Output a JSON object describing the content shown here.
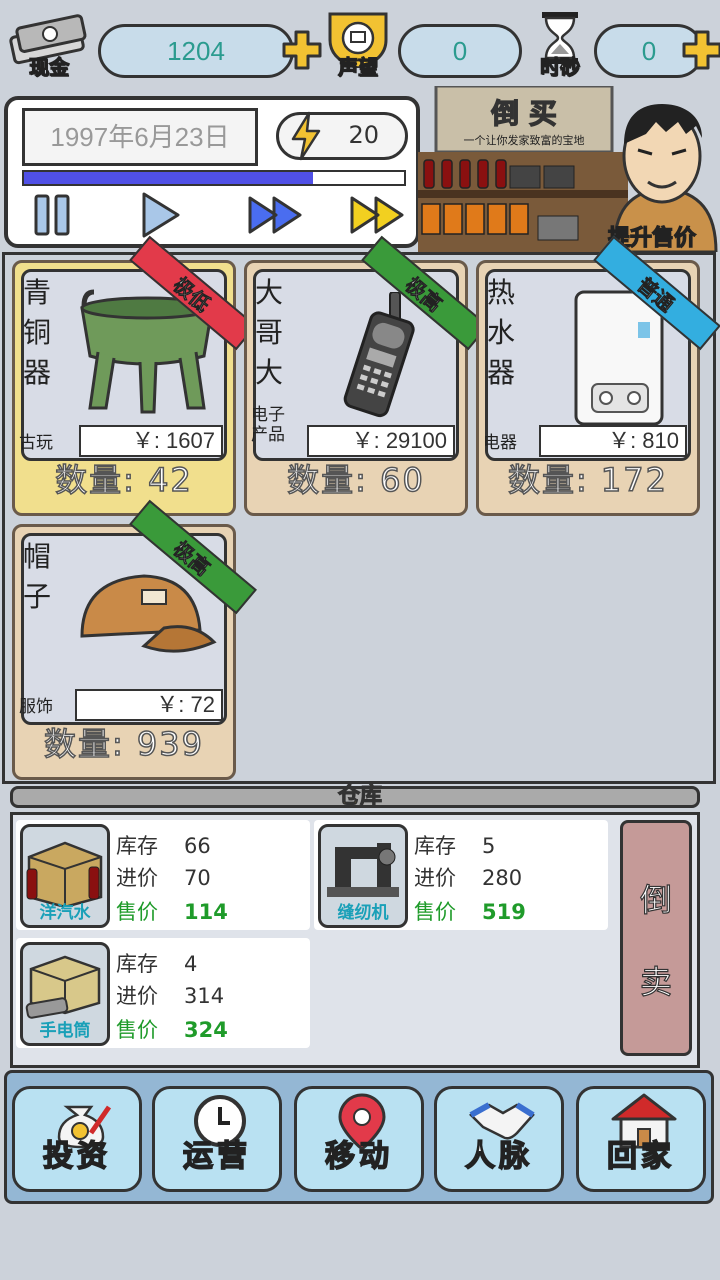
{
  "resources": [
    {
      "label": "现金",
      "value": "1204",
      "icon": "cash-icon"
    },
    {
      "label": "声望",
      "value": "0",
      "icon": "reputation-fist-icon"
    },
    {
      "label": "时砂",
      "value": "0",
      "icon": "hourglass-icon"
    }
  ],
  "clock": {
    "date": "1997年6月23日",
    "energy": "20",
    "progress": 0.76
  },
  "shop": {
    "sign_title": "倒 买",
    "sign_subtitle": "一个让你发家致富的宝地",
    "action_label": "提升售价"
  },
  "items": [
    {
      "name": "青铜器",
      "category": "古玩",
      "price": "￥: 1607",
      "quantity": "数量: 42",
      "tag": "极低",
      "tag_color": "#e23a4a",
      "selected": true
    },
    {
      "name": "大哥大",
      "category": "电子产品",
      "price": "￥: 29100",
      "quantity": "数量: 60",
      "tag": "极高",
      "tag_color": "#3a9a3a",
      "selected": false
    },
    {
      "name": "热水器",
      "category": "电器",
      "price": "￥: 810",
      "quantity": "数量: 172",
      "tag": "普通",
      "tag_color": "#33aee0",
      "selected": false
    },
    {
      "name": "帽子",
      "category": "服饰",
      "price": "￥: 72",
      "quantity": "数量: 939",
      "tag": "极高",
      "tag_color": "#3a9a3a",
      "selected": false
    }
  ],
  "warehouse": {
    "title": "仓库",
    "stock_label": "库存",
    "cost_label": "进价",
    "sell_label": "售价",
    "items": [
      {
        "name": "洋汽水",
        "stock": "66",
        "cost": "70",
        "sell": "114"
      },
      {
        "name": "缝纫机",
        "stock": "5",
        "cost": "280",
        "sell": "519"
      },
      {
        "name": "手电筒",
        "stock": "4",
        "cost": "314",
        "sell": "324"
      }
    ],
    "sell_button": [
      "倒",
      "卖"
    ]
  },
  "nav": [
    {
      "label": "投资",
      "icon": "money-bag-icon"
    },
    {
      "label": "运营",
      "icon": "clock-icon"
    },
    {
      "label": "移动",
      "icon": "location-pin-icon"
    },
    {
      "label": "人脉",
      "icon": "handshake-icon"
    },
    {
      "label": "回家",
      "icon": "house-icon"
    }
  ],
  "colors": {
    "accent": "#5050e6",
    "sell_green": "#1f9b2a",
    "warehouse_title": "#f2c232"
  }
}
